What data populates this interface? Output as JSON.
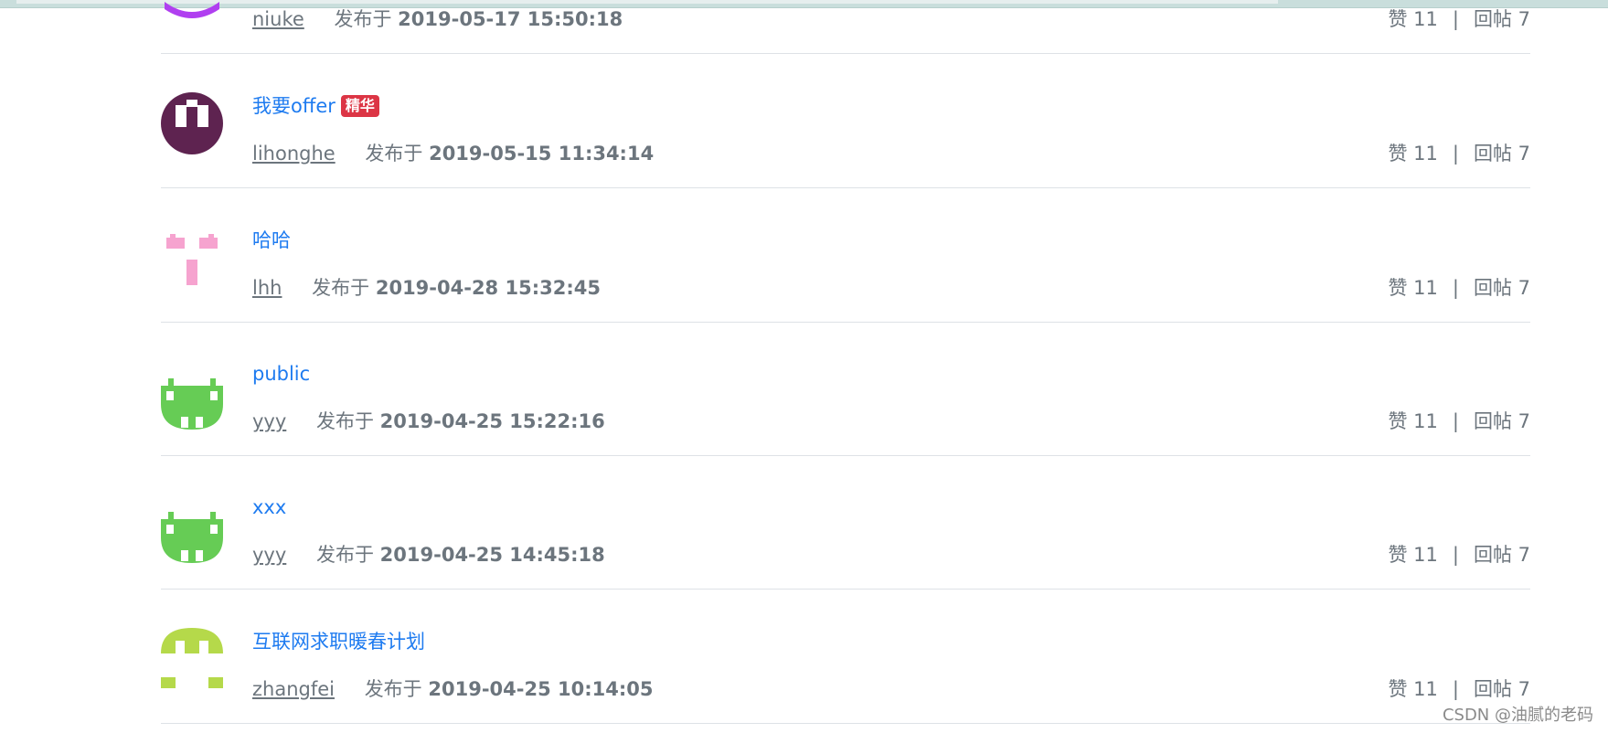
{
  "posts": [
    {
      "title": "",
      "badge": "",
      "author": "niuke",
      "published_label": "发布于",
      "published_time": "2019-05-17 15:50:18",
      "likes": "赞 11",
      "divider": "|",
      "replies": "回帖 7",
      "avatar_color": "#b03ff0"
    },
    {
      "title": "我要offer",
      "badge": "精华",
      "author": "lihonghe",
      "published_label": "发布于",
      "published_time": "2019-05-15 11:34:14",
      "likes": "赞 11",
      "divider": "|",
      "replies": "回帖 7",
      "avatar_color": "#5e2350"
    },
    {
      "title": "哈哈",
      "badge": "",
      "author": "lhh",
      "published_label": "发布于",
      "published_time": "2019-04-28 15:32:45",
      "likes": "赞 11",
      "divider": "|",
      "replies": "回帖 7",
      "avatar_color": "#f6a3cf"
    },
    {
      "title": "public",
      "badge": "",
      "author": "yyy",
      "published_label": "发布于",
      "published_time": "2019-04-25 15:22:16",
      "likes": "赞 11",
      "divider": "|",
      "replies": "回帖 7",
      "avatar_color": "#66cc55"
    },
    {
      "title": "xxx",
      "badge": "",
      "author": "yyy",
      "published_label": "发布于",
      "published_time": "2019-04-25 14:45:18",
      "likes": "赞 11",
      "divider": "|",
      "replies": "回帖 7",
      "avatar_color": "#66cc55"
    },
    {
      "title": "互联网求职暖春计划",
      "badge": "",
      "author": "zhangfei",
      "published_label": "发布于",
      "published_time": "2019-04-25 10:14:05",
      "likes": "赞 11",
      "divider": "|",
      "replies": "回帖 7",
      "avatar_color": "#b5d94a"
    }
  ],
  "watermark": "CSDN @油腻的老码"
}
